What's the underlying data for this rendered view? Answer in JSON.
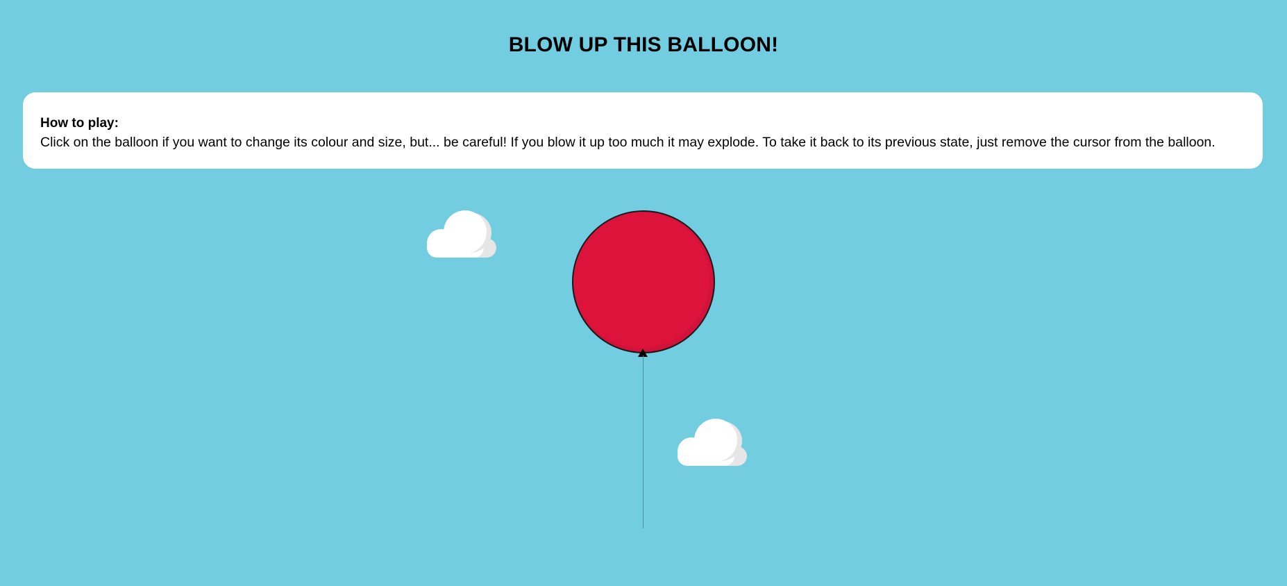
{
  "page": {
    "title": "BLOW UP THIS BALLOON!",
    "background_color": "#72cde0"
  },
  "instructions": {
    "heading": "How to play:",
    "text": "Click on the balloon if you want to change its colour and size, but... be careful! If you blow it up too much it may explode. To take it back to its previous state, just remove the cursor from the balloon."
  },
  "balloon": {
    "color": "#dc143c",
    "icon": "balloon-icon"
  },
  "clouds": {
    "icon": "cloud-icon",
    "count": 2
  }
}
